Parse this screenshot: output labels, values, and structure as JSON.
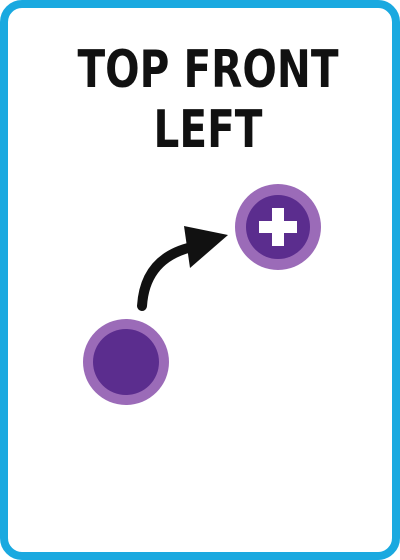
{
  "card": {
    "border_color": "#1aa9e0",
    "title_line_1": "TOP FRONT",
    "title_line_2": "LEFT"
  },
  "diagram": {
    "start_token": {
      "icon": "plain-circle-token",
      "fill": "#5b2d8e",
      "ring": "#9b6bb8"
    },
    "end_token": {
      "icon": "plus-circle-token",
      "fill": "#5b2d8e",
      "ring": "#9b6bb8",
      "symbol_color": "#ffffff"
    },
    "arrow": {
      "icon": "curved-arrow-icon",
      "color": "#111111",
      "direction": "up-right"
    }
  }
}
